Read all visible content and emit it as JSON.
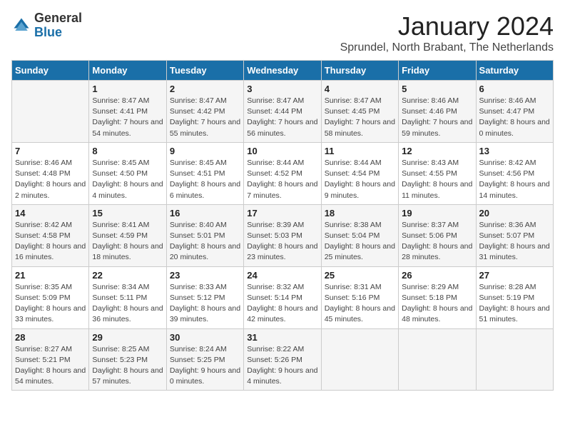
{
  "logo": {
    "general": "General",
    "blue": "Blue"
  },
  "title": "January 2024",
  "location": "Sprundel, North Brabant, The Netherlands",
  "days_of_week": [
    "Sunday",
    "Monday",
    "Tuesday",
    "Wednesday",
    "Thursday",
    "Friday",
    "Saturday"
  ],
  "weeks": [
    [
      {
        "num": "",
        "sunrise": "",
        "sunset": "",
        "daylight": ""
      },
      {
        "num": "1",
        "sunrise": "Sunrise: 8:47 AM",
        "sunset": "Sunset: 4:41 PM",
        "daylight": "Daylight: 7 hours and 54 minutes."
      },
      {
        "num": "2",
        "sunrise": "Sunrise: 8:47 AM",
        "sunset": "Sunset: 4:42 PM",
        "daylight": "Daylight: 7 hours and 55 minutes."
      },
      {
        "num": "3",
        "sunrise": "Sunrise: 8:47 AM",
        "sunset": "Sunset: 4:44 PM",
        "daylight": "Daylight: 7 hours and 56 minutes."
      },
      {
        "num": "4",
        "sunrise": "Sunrise: 8:47 AM",
        "sunset": "Sunset: 4:45 PM",
        "daylight": "Daylight: 7 hours and 58 minutes."
      },
      {
        "num": "5",
        "sunrise": "Sunrise: 8:46 AM",
        "sunset": "Sunset: 4:46 PM",
        "daylight": "Daylight: 7 hours and 59 minutes."
      },
      {
        "num": "6",
        "sunrise": "Sunrise: 8:46 AM",
        "sunset": "Sunset: 4:47 PM",
        "daylight": "Daylight: 8 hours and 0 minutes."
      }
    ],
    [
      {
        "num": "7",
        "sunrise": "Sunrise: 8:46 AM",
        "sunset": "Sunset: 4:48 PM",
        "daylight": "Daylight: 8 hours and 2 minutes."
      },
      {
        "num": "8",
        "sunrise": "Sunrise: 8:45 AM",
        "sunset": "Sunset: 4:50 PM",
        "daylight": "Daylight: 8 hours and 4 minutes."
      },
      {
        "num": "9",
        "sunrise": "Sunrise: 8:45 AM",
        "sunset": "Sunset: 4:51 PM",
        "daylight": "Daylight: 8 hours and 6 minutes."
      },
      {
        "num": "10",
        "sunrise": "Sunrise: 8:44 AM",
        "sunset": "Sunset: 4:52 PM",
        "daylight": "Daylight: 8 hours and 7 minutes."
      },
      {
        "num": "11",
        "sunrise": "Sunrise: 8:44 AM",
        "sunset": "Sunset: 4:54 PM",
        "daylight": "Daylight: 8 hours and 9 minutes."
      },
      {
        "num": "12",
        "sunrise": "Sunrise: 8:43 AM",
        "sunset": "Sunset: 4:55 PM",
        "daylight": "Daylight: 8 hours and 11 minutes."
      },
      {
        "num": "13",
        "sunrise": "Sunrise: 8:42 AM",
        "sunset": "Sunset: 4:56 PM",
        "daylight": "Daylight: 8 hours and 14 minutes."
      }
    ],
    [
      {
        "num": "14",
        "sunrise": "Sunrise: 8:42 AM",
        "sunset": "Sunset: 4:58 PM",
        "daylight": "Daylight: 8 hours and 16 minutes."
      },
      {
        "num": "15",
        "sunrise": "Sunrise: 8:41 AM",
        "sunset": "Sunset: 4:59 PM",
        "daylight": "Daylight: 8 hours and 18 minutes."
      },
      {
        "num": "16",
        "sunrise": "Sunrise: 8:40 AM",
        "sunset": "Sunset: 5:01 PM",
        "daylight": "Daylight: 8 hours and 20 minutes."
      },
      {
        "num": "17",
        "sunrise": "Sunrise: 8:39 AM",
        "sunset": "Sunset: 5:03 PM",
        "daylight": "Daylight: 8 hours and 23 minutes."
      },
      {
        "num": "18",
        "sunrise": "Sunrise: 8:38 AM",
        "sunset": "Sunset: 5:04 PM",
        "daylight": "Daylight: 8 hours and 25 minutes."
      },
      {
        "num": "19",
        "sunrise": "Sunrise: 8:37 AM",
        "sunset": "Sunset: 5:06 PM",
        "daylight": "Daylight: 8 hours and 28 minutes."
      },
      {
        "num": "20",
        "sunrise": "Sunrise: 8:36 AM",
        "sunset": "Sunset: 5:07 PM",
        "daylight": "Daylight: 8 hours and 31 minutes."
      }
    ],
    [
      {
        "num": "21",
        "sunrise": "Sunrise: 8:35 AM",
        "sunset": "Sunset: 5:09 PM",
        "daylight": "Daylight: 8 hours and 33 minutes."
      },
      {
        "num": "22",
        "sunrise": "Sunrise: 8:34 AM",
        "sunset": "Sunset: 5:11 PM",
        "daylight": "Daylight: 8 hours and 36 minutes."
      },
      {
        "num": "23",
        "sunrise": "Sunrise: 8:33 AM",
        "sunset": "Sunset: 5:12 PM",
        "daylight": "Daylight: 8 hours and 39 minutes."
      },
      {
        "num": "24",
        "sunrise": "Sunrise: 8:32 AM",
        "sunset": "Sunset: 5:14 PM",
        "daylight": "Daylight: 8 hours and 42 minutes."
      },
      {
        "num": "25",
        "sunrise": "Sunrise: 8:31 AM",
        "sunset": "Sunset: 5:16 PM",
        "daylight": "Daylight: 8 hours and 45 minutes."
      },
      {
        "num": "26",
        "sunrise": "Sunrise: 8:29 AM",
        "sunset": "Sunset: 5:18 PM",
        "daylight": "Daylight: 8 hours and 48 minutes."
      },
      {
        "num": "27",
        "sunrise": "Sunrise: 8:28 AM",
        "sunset": "Sunset: 5:19 PM",
        "daylight": "Daylight: 8 hours and 51 minutes."
      }
    ],
    [
      {
        "num": "28",
        "sunrise": "Sunrise: 8:27 AM",
        "sunset": "Sunset: 5:21 PM",
        "daylight": "Daylight: 8 hours and 54 minutes."
      },
      {
        "num": "29",
        "sunrise": "Sunrise: 8:25 AM",
        "sunset": "Sunset: 5:23 PM",
        "daylight": "Daylight: 8 hours and 57 minutes."
      },
      {
        "num": "30",
        "sunrise": "Sunrise: 8:24 AM",
        "sunset": "Sunset: 5:25 PM",
        "daylight": "Daylight: 9 hours and 0 minutes."
      },
      {
        "num": "31",
        "sunrise": "Sunrise: 8:22 AM",
        "sunset": "Sunset: 5:26 PM",
        "daylight": "Daylight: 9 hours and 4 minutes."
      },
      {
        "num": "",
        "sunrise": "",
        "sunset": "",
        "daylight": ""
      },
      {
        "num": "",
        "sunrise": "",
        "sunset": "",
        "daylight": ""
      },
      {
        "num": "",
        "sunrise": "",
        "sunset": "",
        "daylight": ""
      }
    ]
  ]
}
